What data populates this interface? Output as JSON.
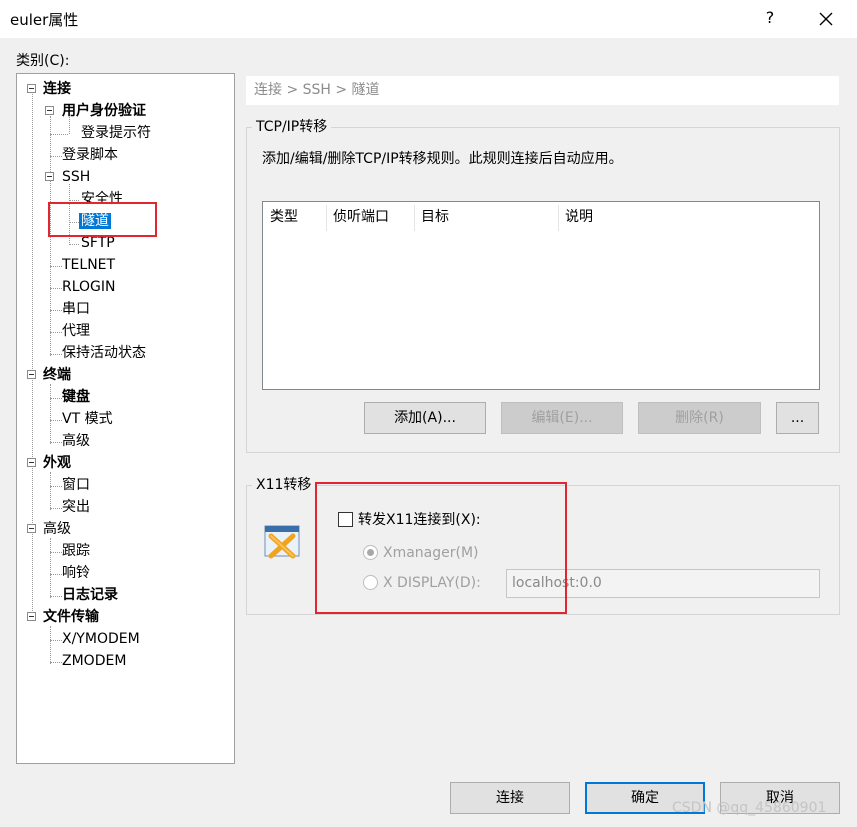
{
  "window": {
    "title": "euler属性",
    "help_label": "?"
  },
  "category_label": "类别(C):",
  "tree": {
    "items": [
      {
        "label": "连接",
        "bold": true
      },
      {
        "label": "用户身份验证",
        "bold": true
      },
      {
        "label": "登录提示符",
        "bold": false
      },
      {
        "label": "登录脚本",
        "bold": false
      },
      {
        "label": "SSH",
        "bold": false
      },
      {
        "label": "安全性",
        "bold": false
      },
      {
        "label": "隧道",
        "bold": false,
        "selected": true
      },
      {
        "label": "SFTP",
        "bold": false
      },
      {
        "label": "TELNET",
        "bold": false
      },
      {
        "label": "RLOGIN",
        "bold": false
      },
      {
        "label": "串口",
        "bold": false
      },
      {
        "label": "代理",
        "bold": false
      },
      {
        "label": "保持活动状态",
        "bold": false
      },
      {
        "label": "终端",
        "bold": true
      },
      {
        "label": "键盘",
        "bold": true
      },
      {
        "label": "VT 模式",
        "bold": false
      },
      {
        "label": "高级",
        "bold": false
      },
      {
        "label": "外观",
        "bold": true
      },
      {
        "label": "窗口",
        "bold": false
      },
      {
        "label": "突出",
        "bold": false
      },
      {
        "label": "高级",
        "bold": false
      },
      {
        "label": "跟踪",
        "bold": false
      },
      {
        "label": "响铃",
        "bold": false
      },
      {
        "label": "日志记录",
        "bold": true
      },
      {
        "label": "文件传输",
        "bold": true
      },
      {
        "label": "X/YMODEM",
        "bold": false
      },
      {
        "label": "ZMODEM",
        "bold": false
      }
    ]
  },
  "breadcrumb": "连接 > SSH > 隧道",
  "tcp": {
    "title": "TCP/IP转移",
    "description": "添加/编辑/删除TCP/IP转移规则。此规则连接后自动应用。",
    "columns": [
      "类型",
      "侦听端口",
      "目标",
      "说明"
    ],
    "add_label": "添加(A)...",
    "edit_label": "编辑(E)...",
    "delete_label": "删除(R)",
    "more_label": "..."
  },
  "x11": {
    "title": "X11转移",
    "forward_label": "转发X11连接到(X):",
    "forward_checked": false,
    "xmanager_label": "Xmanager(M)",
    "xdisplay_label": "X DISPLAY(D):",
    "xdisplay_value": "localhost:0.0",
    "icon": "xmanager-icon"
  },
  "footer": {
    "connect_label": "连接",
    "ok_label": "确定",
    "cancel_label": "取消"
  },
  "watermark": "CSDN @qq_45860901",
  "colors": {
    "selection": "#0078d7",
    "highlight_box": "#e0272f"
  }
}
